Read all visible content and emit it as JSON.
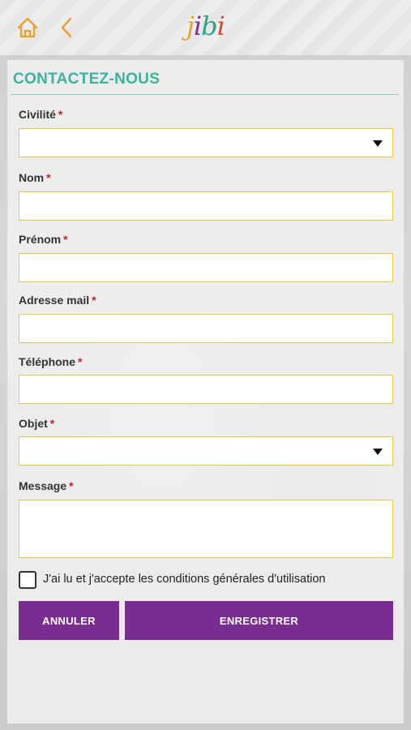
{
  "header": {
    "home_icon": "home-icon",
    "back_icon": "chevron-left-icon",
    "logo_letters": [
      "j",
      "i",
      "b",
      "i"
    ]
  },
  "form": {
    "title": "CONTACTEZ-NOUS",
    "required_mark": "*",
    "fields": {
      "civilite": {
        "label": "Civilité",
        "value": ""
      },
      "nom": {
        "label": "Nom",
        "value": ""
      },
      "prenom": {
        "label": "Prénom",
        "value": ""
      },
      "email": {
        "label": "Adresse mail",
        "value": ""
      },
      "telephone": {
        "label": "Téléphone",
        "value": ""
      },
      "objet": {
        "label": "Objet",
        "value": ""
      },
      "message": {
        "label": "Message",
        "value": ""
      }
    },
    "terms_label": "J'ai lu et j'accepte les conditions générales d'utilisation",
    "terms_checked": false,
    "cancel_label": "ANNULER",
    "save_label": "ENREGISTRER"
  },
  "colors": {
    "accent_green": "#3bb49a",
    "button_purple": "#7a2d90",
    "field_border": "#e7c74c",
    "required_red": "#c0202a"
  }
}
